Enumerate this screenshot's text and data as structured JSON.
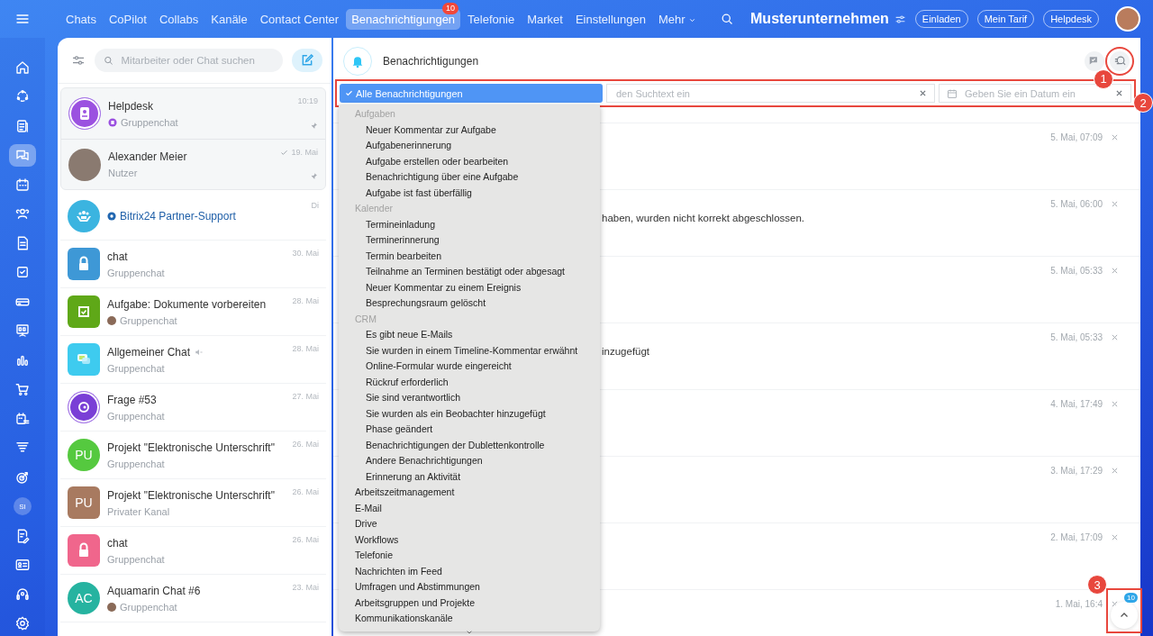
{
  "nav": {
    "items": [
      {
        "label": "Chats",
        "selected": false
      },
      {
        "label": "CoPilot",
        "selected": false
      },
      {
        "label": "Collabs",
        "selected": false
      },
      {
        "label": "Kanäle",
        "selected": false
      },
      {
        "label": "Contact Center",
        "selected": false
      },
      {
        "label": "Benachrichtigungen",
        "selected": true,
        "badge": "10"
      },
      {
        "label": "Telefonie",
        "selected": false
      },
      {
        "label": "Market",
        "selected": false
      },
      {
        "label": "Einstellungen",
        "selected": false
      },
      {
        "label": "Mehr",
        "selected": false,
        "dropdown": true
      }
    ],
    "company": "Musterunternehmen",
    "buttons": [
      "Einladen",
      "Mein Tarif",
      "Helpdesk"
    ]
  },
  "rail": {
    "items": [
      {
        "kind": "home",
        "selected": false
      },
      {
        "kind": "orbit",
        "selected": false
      },
      {
        "kind": "feed",
        "selected": false
      },
      {
        "kind": "chat",
        "selected": true
      },
      {
        "kind": "calendar",
        "selected": false
      },
      {
        "kind": "people",
        "selected": false
      },
      {
        "kind": "doc",
        "selected": false
      },
      {
        "kind": "check",
        "selected": false
      },
      {
        "kind": "drive",
        "selected": false
      },
      {
        "kind": "board",
        "selected": false
      },
      {
        "kind": "bars",
        "selected": false
      },
      {
        "kind": "cart",
        "selected": false
      },
      {
        "kind": "planner",
        "selected": false
      },
      {
        "kind": "funnel",
        "selected": false
      },
      {
        "kind": "target",
        "selected": false
      },
      {
        "kind": "text",
        "label": "SI",
        "selected": false
      },
      {
        "kind": "sign",
        "selected": false
      },
      {
        "kind": "card",
        "selected": false
      },
      {
        "kind": "headset",
        "selected": false
      },
      {
        "kind": "gear",
        "selected": false
      }
    ]
  },
  "chat_list": {
    "search": {
      "placeholder": "Mitarbeiter oder Chat suchen"
    },
    "chats": [
      {
        "name": "Helpdesk",
        "subtitle": "Gruppenchat",
        "time": "10:19",
        "kind": "helpdesk",
        "color": "#9b51e0",
        "member_photo": false,
        "pinned": true,
        "read": false,
        "muted": false,
        "link": false
      },
      {
        "name": "Alexander Meier",
        "subtitle": "Nutzer",
        "time": "19. Mai",
        "kind": "photo",
        "color": "#8a7a70",
        "member_photo": false,
        "pinned": true,
        "read": true,
        "muted": false,
        "link": false
      },
      {
        "name": "Bitrix24 Partner-Support",
        "time": "Di",
        "kind": "partner",
        "color": "#3bb4e0",
        "member_photo": false,
        "pinned": false,
        "read": false,
        "muted": false,
        "link": true
      },
      {
        "name": "chat",
        "subtitle": "Gruppenchat",
        "time": "30. Mai",
        "kind": "lock",
        "color": "#3e98d6",
        "member_photo": false,
        "pinned": false,
        "read": false,
        "muted": false,
        "link": false
      },
      {
        "name": "Aufgabe: Dokumente vorbereiten",
        "subtitle": "Gruppenchat",
        "time": "28. Mai",
        "kind": "task",
        "color": "#5fa818",
        "member_photo": true,
        "pinned": false,
        "read": false,
        "muted": false,
        "link": false
      },
      {
        "name": "Allgemeiner Chat",
        "subtitle": "Gruppenchat",
        "time": "28. Mai",
        "kind": "general",
        "color": "#3ecbef",
        "member_photo": false,
        "pinned": false,
        "read": false,
        "muted": true,
        "link": false
      },
      {
        "name": "Frage #53",
        "subtitle": "Gruppenchat",
        "time": "27. Mai",
        "kind": "question",
        "color": "#7a3fd6",
        "member_photo": false,
        "pinned": false,
        "read": false,
        "muted": false,
        "link": false
      },
      {
        "name": "Projekt \"Elektronische Unterschrift\"",
        "subtitle": "Gruppenchat",
        "time": "26. Mai",
        "kind": "initials-round",
        "initials": "PU",
        "color": "#55c93f",
        "member_photo": false,
        "pinned": false,
        "read": false,
        "muted": false,
        "link": false
      },
      {
        "name": "Projekt \"Elektronische Unterschrift\"",
        "subtitle": "Privater Kanal",
        "time": "26. Mai",
        "kind": "initials-square",
        "initials": "PU",
        "color": "#a87a60",
        "member_photo": false,
        "pinned": false,
        "read": false,
        "muted": false,
        "link": false
      },
      {
        "name": "chat",
        "subtitle": "Gruppenchat",
        "time": "26. Mai",
        "kind": "lock",
        "color": "#f0668c",
        "member_photo": false,
        "pinned": false,
        "read": false,
        "muted": false,
        "link": false
      },
      {
        "name": "Aquamarin Chat #6",
        "subtitle": "Gruppenchat",
        "time": "23. Mai",
        "kind": "initials-round",
        "initials": "AC",
        "color": "#26b3a0",
        "member_photo": true,
        "pinned": false,
        "read": false,
        "muted": false,
        "link": false
      }
    ]
  },
  "main": {
    "title": "Benachrichtigungen",
    "actions": [
      {
        "kind": "chat-check"
      },
      {
        "kind": "search-list",
        "callout": "1"
      }
    ],
    "filters": {
      "callout": "2",
      "search": {
        "placeholder": "den Suchtext ein"
      },
      "date": {
        "placeholder": "Geben Sie ein Datum ein"
      }
    },
    "dropdown": {
      "options": [
        {
          "kind": "top",
          "label": "Alle Benachrichtigungen",
          "selected": true
        },
        {
          "kind": "header",
          "label": "Aufgaben",
          "selected": false
        },
        {
          "kind": "sub",
          "label": "Neuer Kommentar zur Aufgabe",
          "selected": false
        },
        {
          "kind": "sub",
          "label": "Aufgabenerinnerung",
          "selected": false
        },
        {
          "kind": "sub",
          "label": "Aufgabe erstellen oder bearbeiten",
          "selected": false
        },
        {
          "kind": "sub",
          "label": "Benachrichtigung über eine Aufgabe",
          "selected": false
        },
        {
          "kind": "sub",
          "label": "Aufgabe ist fast überfällig",
          "selected": false
        },
        {
          "kind": "header",
          "label": "Kalender",
          "selected": false
        },
        {
          "kind": "sub",
          "label": "Termineinladung",
          "selected": false
        },
        {
          "kind": "sub",
          "label": "Terminerinnerung",
          "selected": false
        },
        {
          "kind": "sub",
          "label": "Termin bearbeiten",
          "selected": false
        },
        {
          "kind": "sub",
          "label": "Teilnahme an Terminen bestätigt oder abgesagt",
          "selected": false
        },
        {
          "kind": "sub",
          "label": "Neuer Kommentar zu einem Ereignis",
          "selected": false
        },
        {
          "kind": "sub",
          "label": "Besprechungsraum gelöscht",
          "selected": false
        },
        {
          "kind": "header",
          "label": "CRM",
          "selected": false
        },
        {
          "kind": "sub",
          "label": "Es gibt neue E-Mails",
          "selected": false
        },
        {
          "kind": "sub",
          "label": "Sie wurden in einem Timeline-Kommentar erwähnt",
          "selected": false
        },
        {
          "kind": "sub",
          "label": "Online-Formular wurde eingereicht",
          "selected": false
        },
        {
          "kind": "sub",
          "label": "Rückruf erforderlich",
          "selected": false
        },
        {
          "kind": "sub",
          "label": "Sie sind verantwortlich",
          "selected": false
        },
        {
          "kind": "sub",
          "label": "Sie wurden als ein Beobachter hinzugefügt",
          "selected": false
        },
        {
          "kind": "sub",
          "label": "Phase geändert",
          "selected": false
        },
        {
          "kind": "sub",
          "label": "Benachrichtigungen der Dublettenkontrolle",
          "selected": false
        },
        {
          "kind": "sub",
          "label": "Andere Benachrichtigungen",
          "selected": false
        },
        {
          "kind": "sub",
          "label": "Erinnerung an Aktivität",
          "selected": false
        },
        {
          "kind": "top",
          "label": "Arbeitszeitmanagement",
          "selected": false
        },
        {
          "kind": "top",
          "label": "E-Mail",
          "selected": false
        },
        {
          "kind": "top",
          "label": "Drive",
          "selected": false
        },
        {
          "kind": "top",
          "label": "Workflows",
          "selected": false
        },
        {
          "kind": "top",
          "label": "Telefonie",
          "selected": false
        },
        {
          "kind": "top",
          "label": "Nachrichten im Feed",
          "selected": false
        },
        {
          "kind": "top",
          "label": "Umfragen und Abstimmungen",
          "selected": false
        },
        {
          "kind": "top",
          "label": "Arbeitsgruppen und Projekte",
          "selected": false
        },
        {
          "kind": "top",
          "label": "Kommunikationskanäle",
          "selected": false
        }
      ]
    },
    "notifications": [
      {
        "time": "5. Mai, 07:09"
      },
      {
        "time": "5. Mai, 06:00",
        "text": "haben, wurden nicht korrekt abgeschlossen."
      },
      {
        "time": "5. Mai, 05:33"
      },
      {
        "time": "5. Mai, 05:33",
        "text": "inzugefügt"
      },
      {
        "time": "4. Mai, 17:49"
      },
      {
        "time": "3. Mai, 17:29"
      },
      {
        "time": "2. Mai, 17:09"
      },
      {
        "time": "1. Mai, 16:4"
      }
    ],
    "scroll_button": {
      "badge": "10",
      "callout": "3"
    }
  }
}
